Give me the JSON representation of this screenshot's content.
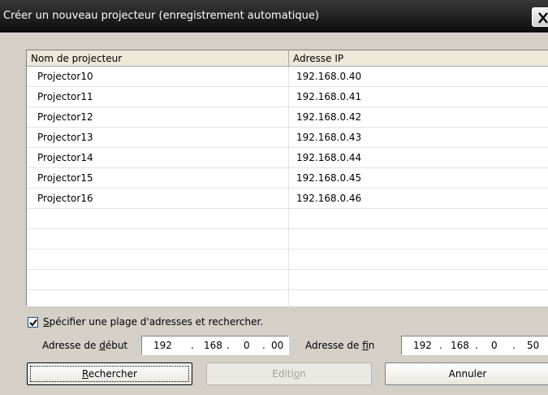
{
  "dialog": {
    "title": "Créer un nouveau projecteur (enregistrement automatique)"
  },
  "list": {
    "headers": {
      "name": "Nom de projecteur",
      "ip": "Adresse IP"
    },
    "rows": [
      {
        "name": "Projector10",
        "ip": "192.168.0.40"
      },
      {
        "name": "Projector11",
        "ip": "192.168.0.41"
      },
      {
        "name": "Projector12",
        "ip": "192.168.0.42"
      },
      {
        "name": "Projector13",
        "ip": "192.168.0.43"
      },
      {
        "name": "Projector14",
        "ip": "192.168.0.44"
      },
      {
        "name": "Projector15",
        "ip": "192.168.0.45"
      },
      {
        "name": "Projector16",
        "ip": "192.168.0.46"
      }
    ]
  },
  "range": {
    "checkbox_checked": true,
    "checkbox_label_mnemonic": "S",
    "checkbox_label_rest": "pécifier une plage d'adresses et rechercher.",
    "start_label_prefix": "Adresse de ",
    "start_label_mnemonic": "d",
    "start_label_suffix": "ébut",
    "start_ip": [
      "192",
      "168",
      "0",
      "00"
    ],
    "end_label_prefix": "Adresse de ",
    "end_label_mnemonic": "f",
    "end_label_suffix": "in",
    "end_ip": [
      "192",
      "168",
      "0",
      "50"
    ],
    "dot": "."
  },
  "buttons": {
    "search_mnemonic": "R",
    "search_rest": "echercher",
    "edit_prefix": "Editi",
    "edit_mnemonic": "o",
    "edit_suffix": "n",
    "cancel": "Annuler"
  },
  "icons": {
    "close": "close-icon",
    "check": "check-icon"
  }
}
